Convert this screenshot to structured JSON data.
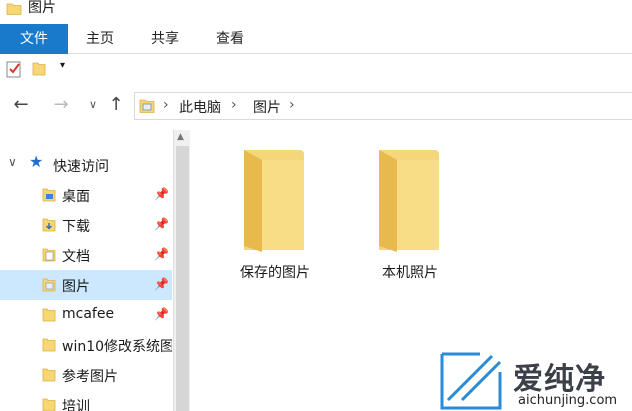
{
  "window": {
    "title": "图片"
  },
  "ribbon": {
    "tabs": [
      {
        "label": "文件",
        "active": true
      },
      {
        "label": "主页"
      },
      {
        "label": "共享"
      },
      {
        "label": "查看"
      }
    ]
  },
  "quick_access_toolbar": {
    "dropdown_glyph": "▾"
  },
  "address_bar": {
    "crumbs": [
      "此电脑",
      "图片"
    ],
    "separator": "›"
  },
  "sidebar": {
    "quick_access_label": "快速访问",
    "items": [
      {
        "label": "桌面",
        "icon": "desktop-folder-icon",
        "pinned": true
      },
      {
        "label": "下载",
        "icon": "download-folder-icon",
        "pinned": true
      },
      {
        "label": "文档",
        "icon": "documents-folder-icon",
        "pinned": true
      },
      {
        "label": "图片",
        "icon": "pictures-folder-icon",
        "pinned": true,
        "selected": true
      },
      {
        "label": "mcafee",
        "icon": "folder-icon",
        "pinned": true
      },
      {
        "label": "win10修改系统图",
        "icon": "folder-icon"
      },
      {
        "label": "参考图片",
        "icon": "folder-icon"
      },
      {
        "label": "培训",
        "icon": "folder-icon"
      }
    ]
  },
  "content": {
    "folders": [
      {
        "label": "保存的图片"
      },
      {
        "label": "本机照片"
      }
    ]
  },
  "watermark": {
    "brand": "爱纯净",
    "url": "aichunjing.com"
  },
  "colors": {
    "file_tab": "#1979ca",
    "selected_item": "#cce8ff",
    "folder_yellow": "#f7d673"
  }
}
